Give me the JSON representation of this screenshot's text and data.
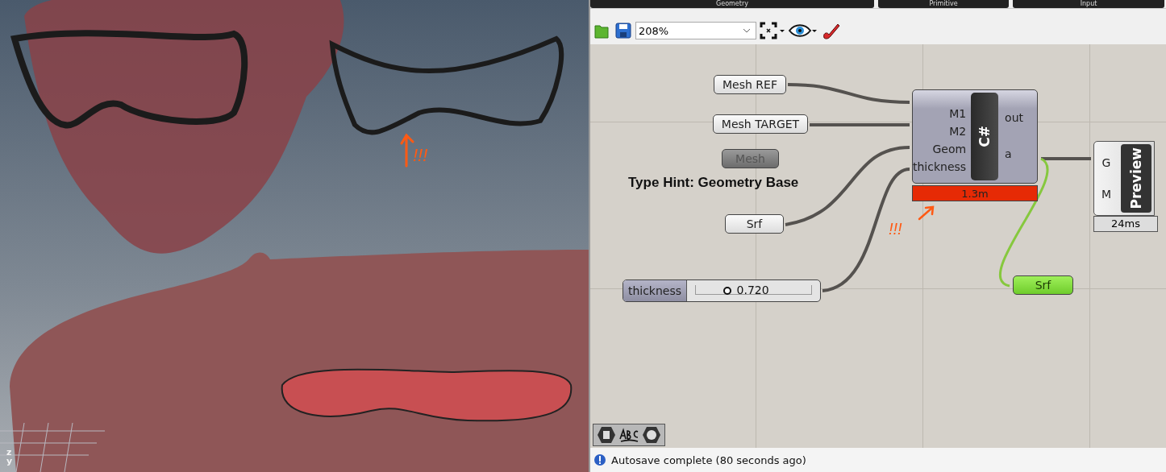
{
  "viewport": {
    "annotation": "!!!",
    "axes": [
      "z",
      "y"
    ]
  },
  "panel_tabs": [
    {
      "label": "Geometry"
    },
    {
      "label": "Primitive"
    },
    {
      "label": "Input"
    }
  ],
  "toolbar": {
    "zoom": "208%"
  },
  "canvas": {
    "params": [
      {
        "label": "Mesh REF",
        "disabled": false,
        "selected": false
      },
      {
        "label": "Mesh TARGET",
        "disabled": false,
        "selected": false
      },
      {
        "label": "Mesh",
        "disabled": true,
        "selected": false
      },
      {
        "label": "Srf",
        "disabled": false,
        "selected": false
      },
      {
        "label": "Srf",
        "disabled": false,
        "selected": true
      }
    ],
    "hint": "Type Hint: Geometry Base",
    "script_component": {
      "label": "C#",
      "inputs": [
        "M1",
        "M2",
        "Geom",
        "thickness"
      ],
      "outputs": [
        "out",
        "a"
      ],
      "time": "1.3m",
      "error": true
    },
    "slider": {
      "name": "thickness",
      "value": "0.720",
      "level": 0.27
    },
    "preview": {
      "label": "Preview",
      "inputs": [
        "G",
        "M"
      ],
      "time": "24ms"
    },
    "annotation": "!!!"
  },
  "status_bar": {
    "message": "Autosave complete (80 seconds ago)"
  }
}
